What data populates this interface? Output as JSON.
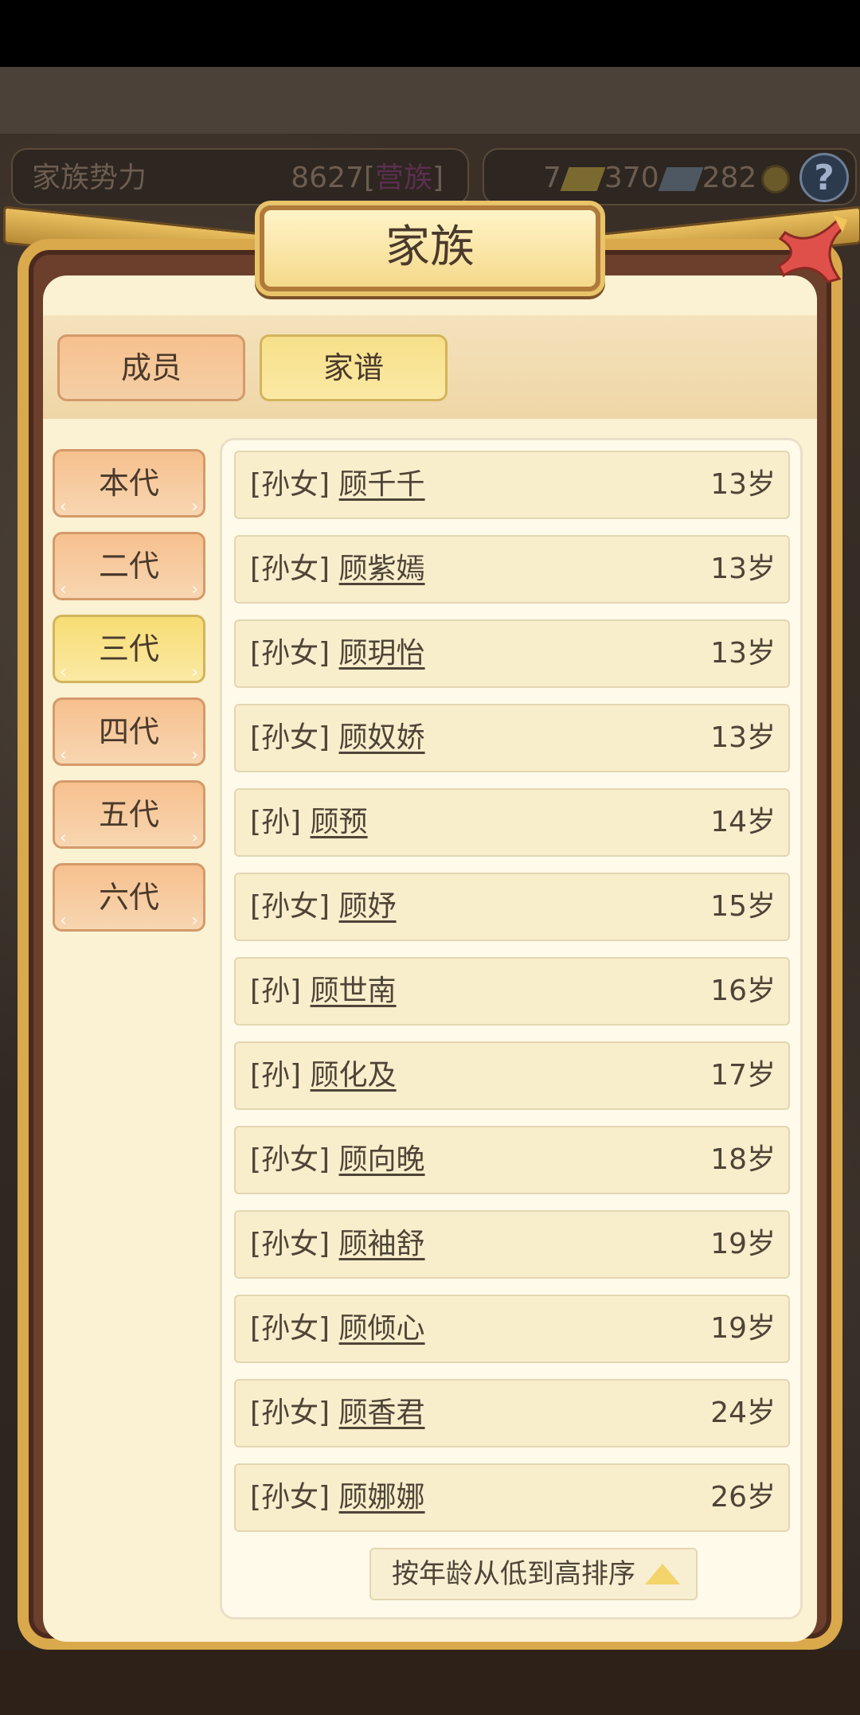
{
  "top_bar": {
    "power_label": "家族势力",
    "power_value": "8627",
    "power_bracket_open": "[",
    "power_tag": "营族",
    "power_bracket_close": "]",
    "gold_count": "7",
    "ingot_count": "370",
    "silver_count": "282"
  },
  "dialog": {
    "title": "家族",
    "tabs": [
      "成员",
      "家谱"
    ],
    "active_tab": "家谱",
    "generations": [
      "本代",
      "二代",
      "三代",
      "四代",
      "五代",
      "六代"
    ],
    "active_generation": "三代",
    "rows": [
      {
        "relation": "[孙女]",
        "name": "顾千千",
        "age": "13岁"
      },
      {
        "relation": "[孙女]",
        "name": "顾紫嫣",
        "age": "13岁"
      },
      {
        "relation": "[孙女]",
        "name": "顾玥怡",
        "age": "13岁"
      },
      {
        "relation": "[孙女]",
        "name": "顾奴娇",
        "age": "13岁"
      },
      {
        "relation": "[孙]",
        "name": "顾预",
        "age": "14岁"
      },
      {
        "relation": "[孙女]",
        "name": "顾妤",
        "age": "15岁"
      },
      {
        "relation": "[孙]",
        "name": "顾世南",
        "age": "16岁"
      },
      {
        "relation": "[孙]",
        "name": "顾化及",
        "age": "17岁"
      },
      {
        "relation": "[孙女]",
        "name": "顾向晚",
        "age": "18岁"
      },
      {
        "relation": "[孙女]",
        "name": "顾袖舒",
        "age": "19岁"
      },
      {
        "relation": "[孙女]",
        "name": "顾倾心",
        "age": "19岁"
      },
      {
        "relation": "[孙女]",
        "name": "顾香君",
        "age": "24岁"
      },
      {
        "relation": "[孙女]",
        "name": "顾娜娜",
        "age": "26岁"
      }
    ],
    "sort_label": "按年龄从低到高排序"
  },
  "colors": {
    "panel": "#fbf1d3",
    "frame_gold": "#d9a94c",
    "tab_orange": "#f7c08e",
    "tab_yellow": "#f7dd74"
  }
}
